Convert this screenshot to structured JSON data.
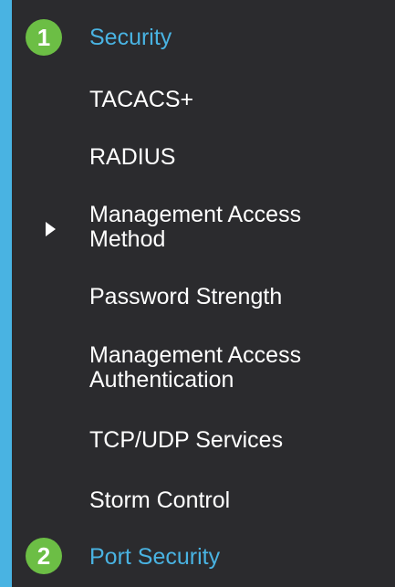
{
  "sidebar": {
    "accent_color": "#49b3e2",
    "badge_color": "#6cbe45",
    "section_security": {
      "badge": "1",
      "label": "Security"
    },
    "items": [
      {
        "label": "TACACS+"
      },
      {
        "label": "RADIUS"
      },
      {
        "label_line1": "Management Access",
        "label_line2": "Method",
        "current": true,
        "indicator_icon": "caret-right-icon"
      },
      {
        "label": "Password Strength"
      },
      {
        "label_line1": "Management Access",
        "label_line2": "Authentication"
      },
      {
        "label": "TCP/UDP Services"
      },
      {
        "label": "Storm Control"
      }
    ],
    "section_port_security": {
      "badge": "2",
      "label": "Port Security"
    }
  }
}
